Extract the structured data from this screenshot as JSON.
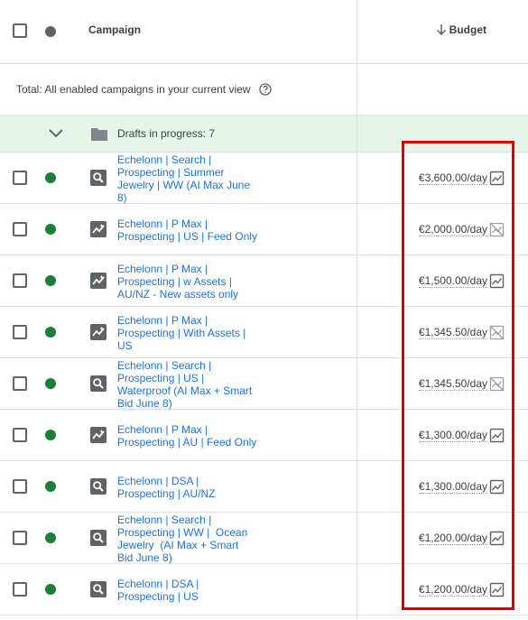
{
  "header": {
    "campaign_label": "Campaign",
    "budget_label": "Budget"
  },
  "total_row": {
    "text": "Total: All enabled campaigns in your current view"
  },
  "drafts_row": {
    "text": "Drafts in progress: 7"
  },
  "colors": {
    "link": "#1a73e8",
    "status_enabled": "#188038",
    "drafts_bg": "#e6f4ea",
    "highlight_box": "#e00000"
  },
  "campaigns": [
    {
      "name_lines": [
        "Echelonn | Search |",
        "Prospecting | Summer",
        "Jewelry | WW (AI Max June",
        "8)"
      ],
      "type_icon": "search-icon",
      "budget": "€3,600.00/day",
      "budget_icon": "trend-chart-icon"
    },
    {
      "name_lines": [
        "Echelonn | P Max |",
        "Prospecting | US | Feed Only"
      ],
      "type_icon": "pmax-icon",
      "budget": "€2,000.00/day",
      "budget_icon": "trend-chart-off-icon"
    },
    {
      "name_lines": [
        "Echelonn | P Max |",
        "Prospecting | w Assets |",
        "AU/NZ - New assets only"
      ],
      "type_icon": "pmax-icon",
      "budget": "€1,500.00/day",
      "budget_icon": "trend-chart-icon"
    },
    {
      "name_lines": [
        "Echelonn | P Max |",
        "Prospecting | With Assets |",
        "US"
      ],
      "type_icon": "pmax-icon",
      "budget": "€1,345.50/day",
      "budget_icon": "trend-chart-off-icon"
    },
    {
      "name_lines": [
        "Echelonn | Search |",
        "Prospecting | US |",
        "Waterproof (AI Max + Smart",
        "Bid June 8)"
      ],
      "type_icon": "search-icon",
      "budget": "€1,345.50/day",
      "budget_icon": "trend-chart-off-icon"
    },
    {
      "name_lines": [
        "Echelonn | P Max |",
        "Prospecting | AU | Feed Only"
      ],
      "type_icon": "pmax-icon",
      "budget": "€1,300.00/day",
      "budget_icon": "trend-chart-icon"
    },
    {
      "name_lines": [
        "Echelonn | DSA |",
        "Prospecting | AU/NZ"
      ],
      "type_icon": "search-icon",
      "budget": "€1,300.00/day",
      "budget_icon": "trend-chart-icon"
    },
    {
      "name_lines": [
        "Echelonn | Search |",
        "Prospecting | WW |  Ocean",
        "Jewelry  (AI Max + Smart",
        "Bid June 8)"
      ],
      "type_icon": "search-icon",
      "budget": "€1,200.00/day",
      "budget_icon": "trend-chart-icon"
    },
    {
      "name_lines": [
        "Echelonn | DSA |",
        "Prospecting | US"
      ],
      "type_icon": "search-icon",
      "budget": "€1,200.00/day",
      "budget_icon": "trend-chart-icon"
    }
  ]
}
